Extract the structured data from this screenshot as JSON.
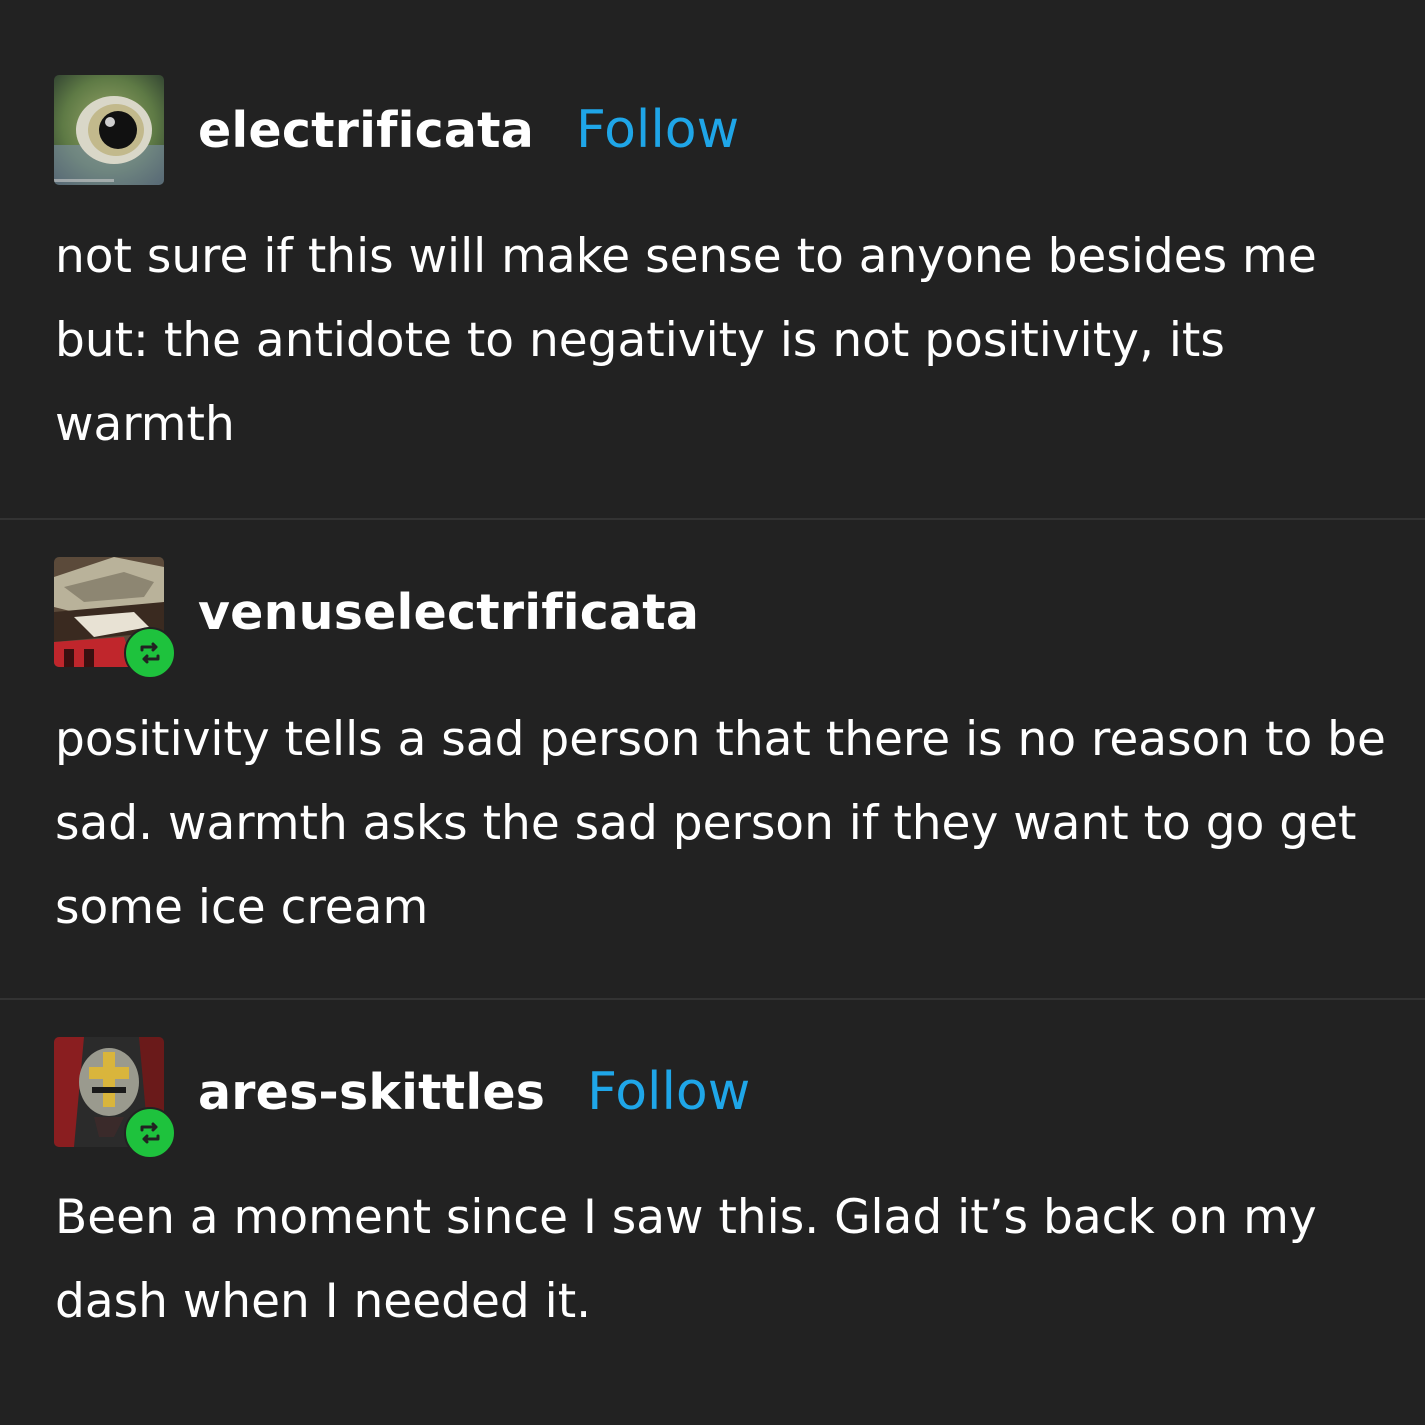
{
  "posts": [
    {
      "username": "electrificata",
      "follow_label": "Follow",
      "avatar_icon": "eye-avatar-icon",
      "reblog": false,
      "text": "not sure if this will make sense to anyone besides me but: the antidote to negativity is not positivity, its warmth"
    },
    {
      "username": "venuselectrificata",
      "avatar_icon": "artwork-avatar-icon",
      "reblog": true,
      "text": "positivity tells a sad person that there is no reason to be sad. warmth asks the sad person if they want to go get some ice cream"
    },
    {
      "username": "ares-skittles",
      "follow_label": "Follow",
      "avatar_icon": "helmet-avatar-icon",
      "reblog": true,
      "text": "Been a moment since I saw this. Glad it’s back on my dash when I needed it."
    }
  ],
  "colors": {
    "background": "#222222",
    "text": "#ffffff",
    "follow": "#1fa6e8",
    "reblog_badge": "#1ec23d",
    "divider": "#333333"
  }
}
